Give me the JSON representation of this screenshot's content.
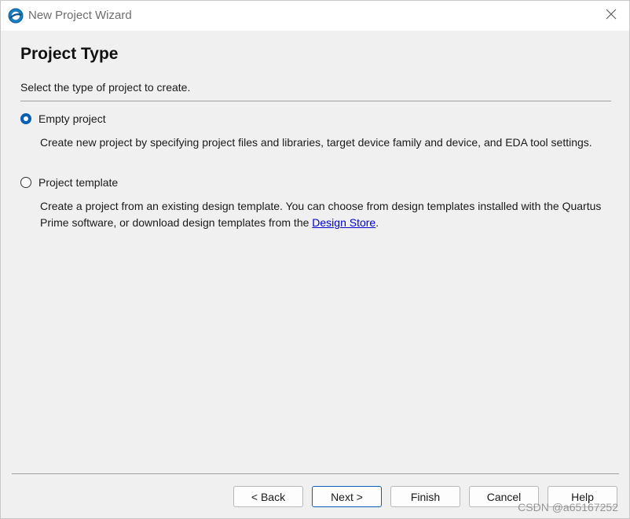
{
  "window": {
    "title": "New Project Wizard"
  },
  "page": {
    "title": "Project Type",
    "subtitle": "Select the type of project to create."
  },
  "options": [
    {
      "label": "Empty project",
      "checked": true,
      "description": "Create new project by specifying project files and libraries, target device family and device, and EDA tool settings."
    },
    {
      "label": "Project template",
      "checked": false,
      "description_before_link": "Create a project from an existing design template. You can choose from design templates installed with the Quartus Prime software, or download design templates from the ",
      "link_text": "Design Store",
      "description_after_link": "."
    }
  ],
  "buttons": {
    "back": "< Back",
    "next": "Next >",
    "finish": "Finish",
    "cancel": "Cancel",
    "help": "Help"
  },
  "watermark": "CSDN @a65167252",
  "colors": {
    "accent": "#0a5fb4",
    "link": "#0000cc"
  },
  "icons": {
    "app": "quartus-app-icon",
    "close": "close-icon"
  }
}
